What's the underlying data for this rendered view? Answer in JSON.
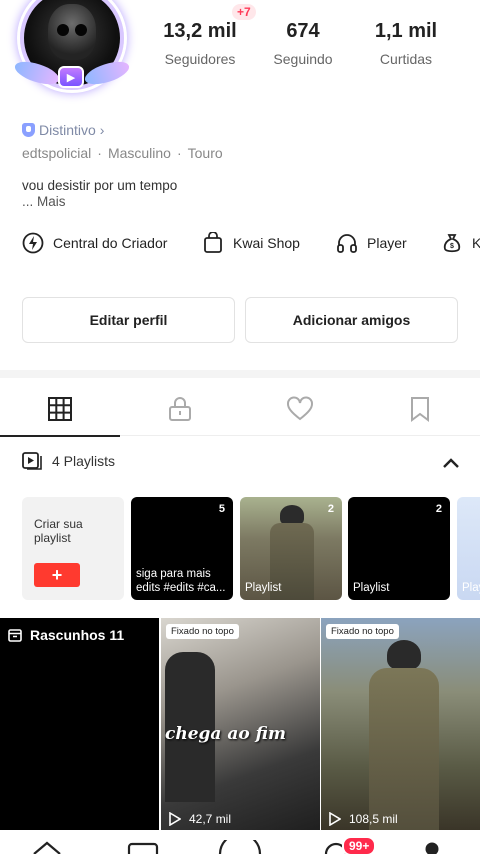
{
  "profile": {
    "stats": [
      {
        "key": "followers",
        "value": "13,2 mil",
        "label": "Seguidores"
      },
      {
        "key": "following",
        "value": "674",
        "label": "Seguindo"
      },
      {
        "key": "likes",
        "value": "1,1 mil",
        "label": "Curtidas"
      }
    ],
    "new_followers_badge": "+7",
    "verified_label": "Distintivo",
    "username": "edtspolicial",
    "gender": "Masculino",
    "sign": "Touro",
    "bio_line": "vou desistir por um tempo",
    "bio_more": "...  Mais"
  },
  "shortcuts": [
    {
      "label": "Central do Criador",
      "icon": "lightning-icon"
    },
    {
      "label": "Kwai Shop",
      "icon": "shopping-bag-icon"
    },
    {
      "label": "Player",
      "icon": "headphones-icon"
    },
    {
      "label": "K",
      "icon": "money-bag-icon"
    }
  ],
  "buttons": {
    "edit_profile": "Editar perfil",
    "add_friends": "Adicionar amigos"
  },
  "tabs": [
    "grid-icon",
    "lock-icon",
    "heart-icon",
    "bookmark-icon"
  ],
  "playlists": {
    "header": "4 Playlists",
    "create_label": "Criar sua playlist",
    "create_button": "+",
    "items": [
      {
        "count": "5",
        "caption": "siga para mais edits #edits #ca..."
      },
      {
        "count": "2",
        "caption": "Playlist"
      },
      {
        "count": "2",
        "caption": "Playlist"
      },
      {
        "count": "",
        "caption": "Play"
      }
    ]
  },
  "videos": {
    "drafts_label": "Rascunhos 11",
    "pinned_label": "Fixado no topo",
    "items": [
      {
        "overlay": "chega ao fim",
        "views": "42,7 mil"
      },
      {
        "overlay": "",
        "views": "108,5 mil"
      }
    ]
  },
  "bottom_nav": {
    "notifications_badge": "99+"
  },
  "colors": {
    "accent_red": "#ff3a2f",
    "badge_pink": "#ff2a4b",
    "muted_text": "#888888"
  }
}
